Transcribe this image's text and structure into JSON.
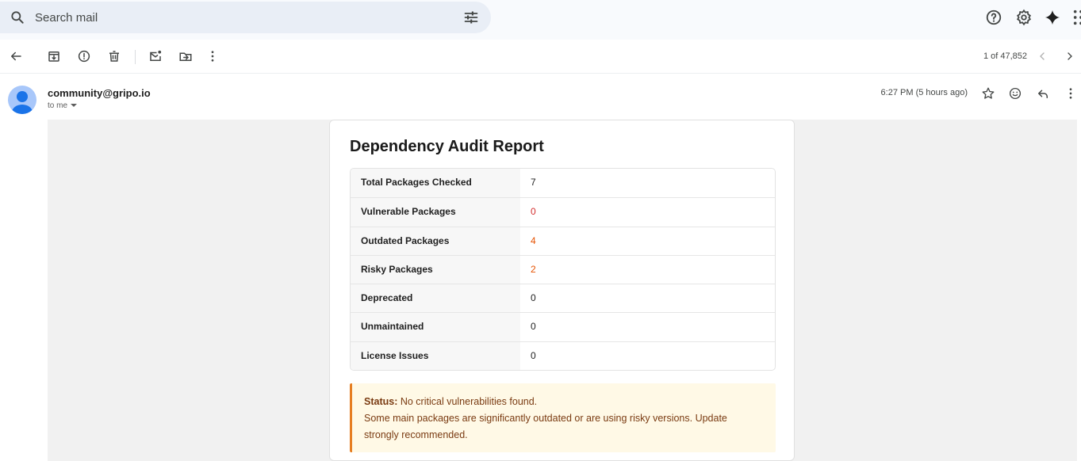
{
  "search": {
    "placeholder": "Search mail"
  },
  "top_icons": [
    "help-icon",
    "settings-icon",
    "gemini-sparkle-icon",
    "apps-grid-icon"
  ],
  "toolbar": {
    "icons": [
      "back-arrow-icon",
      "archive-icon",
      "report-spam-icon",
      "delete-icon",
      "mark-unread-icon",
      "move-to-icon",
      "more-vert-icon"
    ],
    "count": "1 of 47,852"
  },
  "email": {
    "sender": "community@gripo.io",
    "to": "to me",
    "time": "6:27 PM (5 hours ago)",
    "icons": [
      "star-icon",
      "emoji-icon",
      "reply-icon",
      "more-vert-icon"
    ]
  },
  "report": {
    "title": "Dependency Audit Report",
    "rows": [
      {
        "label": "Total Packages Checked",
        "value": "7",
        "color": "#1f1f1f"
      },
      {
        "label": "Vulnerable Packages",
        "value": "0",
        "color": "#d32f2f"
      },
      {
        "label": "Outdated Packages",
        "value": "4",
        "color": "#e65100"
      },
      {
        "label": "Risky Packages",
        "value": "2",
        "color": "#e65100"
      },
      {
        "label": "Deprecated",
        "value": "0",
        "color": "#1f1f1f"
      },
      {
        "label": "Unmaintained",
        "value": "0",
        "color": "#1f1f1f"
      },
      {
        "label": "License Issues",
        "value": "0",
        "color": "#1f1f1f"
      }
    ],
    "status": {
      "label": "Status:",
      "line1": " No critical vulnerabilities found.",
      "line2": "Some main packages are significantly outdated or are using risky versions. Update strongly recommended."
    }
  },
  "colors": {
    "accent_orange": "#e67e22",
    "status_bg": "#fff9e6",
    "search_bg": "#e9eef6"
  }
}
